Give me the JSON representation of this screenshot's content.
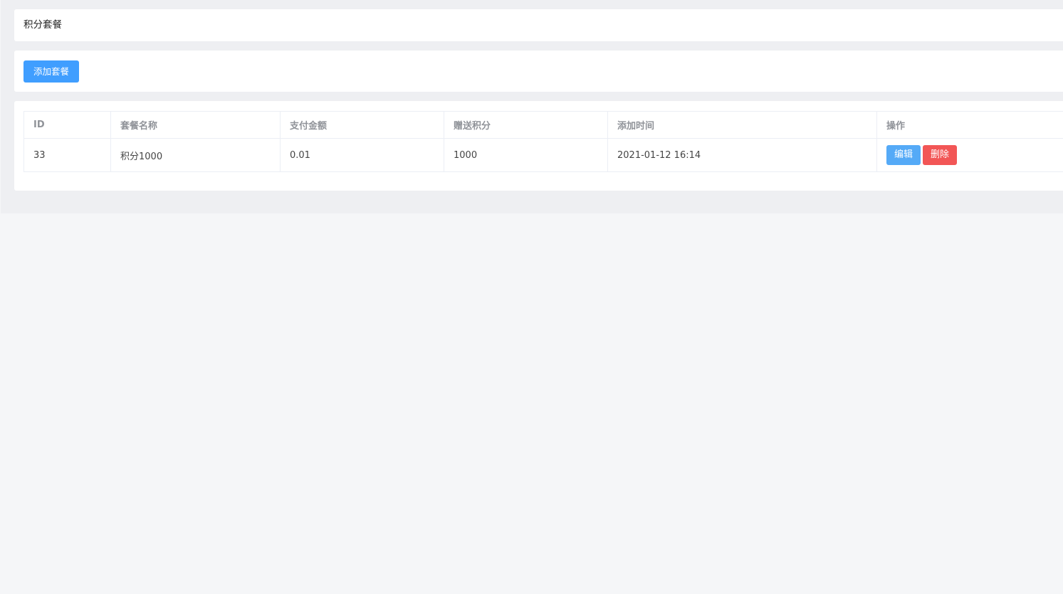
{
  "page": {
    "title": "积分套餐"
  },
  "toolbar": {
    "add_label": "添加套餐"
  },
  "table": {
    "columns": [
      "ID",
      "套餐名称",
      "支付金额",
      "赠送积分",
      "添加时间",
      "操作"
    ],
    "rows": [
      {
        "id": "33",
        "name": "积分1000",
        "amount": "0.01",
        "points": "1000",
        "created": "2021-01-12 16:14",
        "edit_label": "编辑",
        "delete_label": "删除"
      }
    ]
  },
  "colors": {
    "primary": "#409eff",
    "edit": "#55aaf7",
    "danger": "#f25656",
    "header_text": "#909399"
  }
}
